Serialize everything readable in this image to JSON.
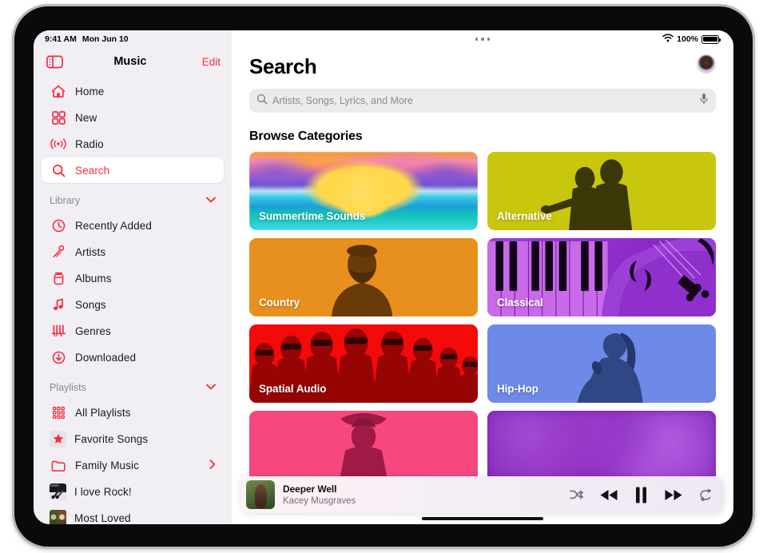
{
  "status_bar": {
    "time": "9:41 AM",
    "date": "Mon Jun 10",
    "battery_percent": "100%",
    "wifi_icon": "wifi-icon",
    "battery_icon": "battery-full-icon",
    "multitask_icon": "multitasking-dots-icon"
  },
  "sidebar": {
    "toggle_icon": "sidebar-toggle-icon",
    "title": "Music",
    "edit_label": "Edit",
    "top_items": [
      {
        "label": "Home",
        "icon": "house-icon",
        "selected": false
      },
      {
        "label": "New",
        "icon": "grid-squares-icon",
        "selected": false
      },
      {
        "label": "Radio",
        "icon": "radio-waves-icon",
        "selected": false
      },
      {
        "label": "Search",
        "icon": "magnifier-icon",
        "selected": true
      }
    ],
    "library": {
      "title": "Library",
      "chevron_icon": "chevron-down-icon",
      "items": [
        {
          "label": "Recently Added",
          "icon": "clock-icon"
        },
        {
          "label": "Artists",
          "icon": "microphone-icon"
        },
        {
          "label": "Albums",
          "icon": "album-stack-icon"
        },
        {
          "label": "Songs",
          "icon": "music-note-icon"
        },
        {
          "label": "Genres",
          "icon": "genres-icon"
        },
        {
          "label": "Downloaded",
          "icon": "download-arrow-icon"
        }
      ]
    },
    "playlists": {
      "title": "Playlists",
      "chevron_icon": "chevron-down-icon",
      "items": [
        {
          "label": "All Playlists",
          "icon": "dots-grid-icon",
          "kind": "icon"
        },
        {
          "label": "Favorite Songs",
          "icon": "star-icon",
          "kind": "star-box"
        },
        {
          "label": "Family Music",
          "icon": "folder-icon",
          "kind": "icon",
          "chevron_icon": "chevron-right-icon"
        },
        {
          "label": "I love Rock!",
          "kind": "artwork"
        },
        {
          "label": "Most Loved",
          "kind": "artwork"
        }
      ]
    }
  },
  "main": {
    "page_title": "Search",
    "avatar_name": "account-avatar",
    "search": {
      "placeholder": "Artists, Songs, Lyrics, and More",
      "value": "",
      "search_icon": "magnifier-icon",
      "mic_icon": "microphone-icon"
    },
    "browse_title": "Browse Categories",
    "categories": [
      {
        "label": "Summertime Sounds",
        "art": "art-summer"
      },
      {
        "label": "Alternative",
        "art": "art-alt"
      },
      {
        "label": "Country",
        "art": "art-country"
      },
      {
        "label": "Classical",
        "art": "art-classical"
      },
      {
        "label": "Spatial Audio",
        "art": "art-spatial"
      },
      {
        "label": "Hip-Hop",
        "art": "art-hiphop"
      },
      {
        "label": "",
        "art": "art-pink"
      },
      {
        "label": "",
        "art": "art-purplecloud"
      }
    ]
  },
  "mini_player": {
    "track_title": "Deeper Well",
    "artist": "Kacey Musgraves",
    "artwork_name": "now-playing-artwork",
    "controls": {
      "shuffle_icon": "shuffle-icon",
      "previous_icon": "rewind-icon",
      "pause_icon": "pause-icon",
      "next_icon": "fast-forward-icon",
      "repeat_icon": "repeat-icon"
    }
  },
  "colors": {
    "accent_red": "#fa2b42",
    "sidebar_bg": "#f1eff4",
    "alternative": "#c9c70d",
    "country": "#e8901e",
    "classical": "#8f2fcc",
    "spatial": "#f50a0a",
    "hiphop": "#6d8ae8"
  }
}
